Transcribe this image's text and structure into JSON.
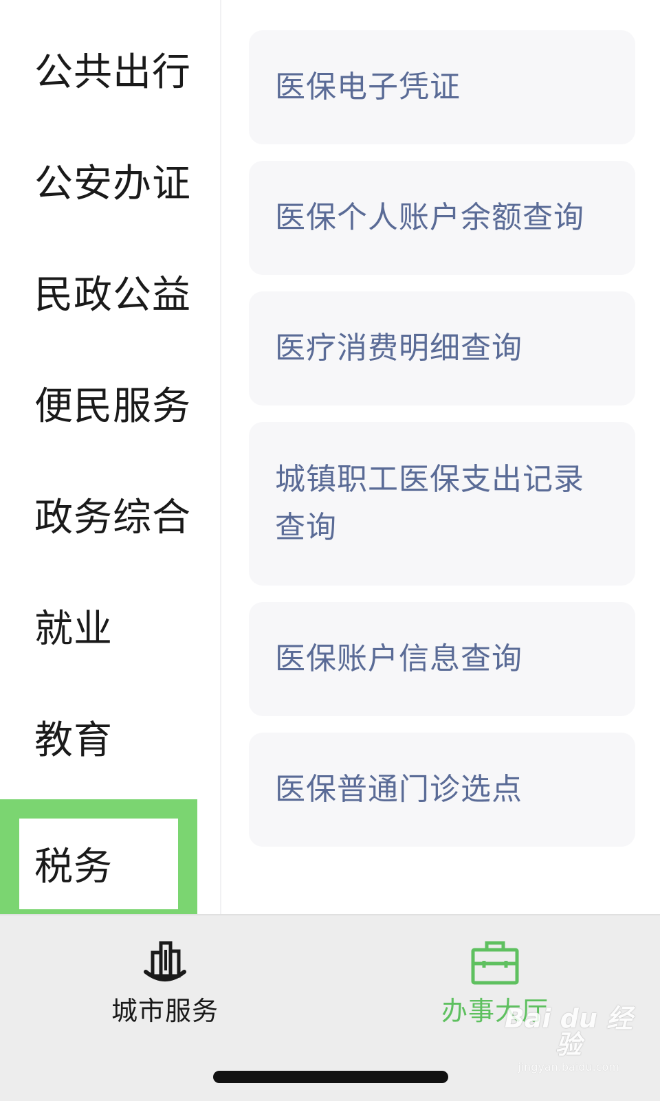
{
  "sidebar": {
    "items": [
      {
        "label": "公共出行"
      },
      {
        "label": "公安办证"
      },
      {
        "label": "民政公益"
      },
      {
        "label": "便民服务"
      },
      {
        "label": "政务综合"
      },
      {
        "label": "就业"
      },
      {
        "label": "教育"
      },
      {
        "label": "税务"
      }
    ]
  },
  "services": [
    {
      "label": "医保电子凭证"
    },
    {
      "label": "医保个人账户余额查询"
    },
    {
      "label": "医疗消费明细查询"
    },
    {
      "label": "城镇职工医保支出记录查询"
    },
    {
      "label": "医保账户信息查询"
    },
    {
      "label": "医保普通门诊选点"
    }
  ],
  "tabbar": {
    "city": {
      "label": "城市服务",
      "icon": "city-building-icon",
      "color": "#1a1a1a"
    },
    "hall": {
      "label": "办事大厅",
      "icon": "briefcase-icon",
      "color": "#5ec05f"
    }
  },
  "colors": {
    "highlight": "#7bd571",
    "service_text": "#5a6b96",
    "card_bg": "#f7f7f9",
    "active_tab": "#5ec05f"
  },
  "watermark": {
    "main": "Bai du 经验",
    "sub": "jingyan.baidu.com"
  }
}
